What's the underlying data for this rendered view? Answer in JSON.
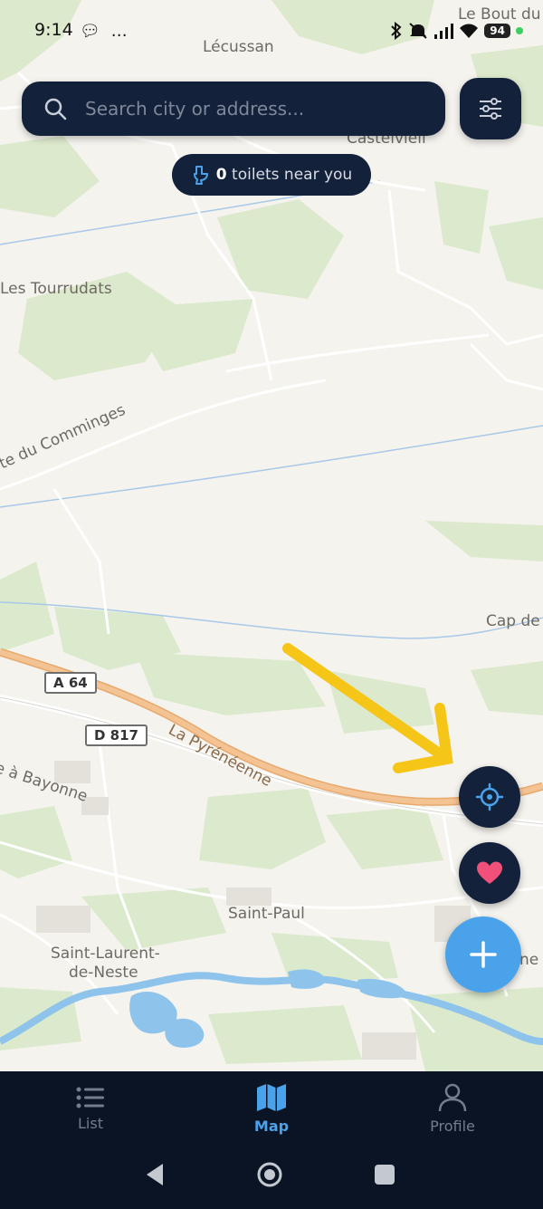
{
  "status_bar": {
    "time": "9:14",
    "battery": "94"
  },
  "search": {
    "placeholder": "Search city or address..."
  },
  "near_you": {
    "count": "0",
    "label": "toilets near you"
  },
  "map_labels": {
    "top_right_place": "Le Bout du",
    "lecussan": "Lécussan",
    "castelvieil": "Castelvieil",
    "tourrudats": "Les Tourrudats",
    "comminges_road": "te du Comminges",
    "cap_de": "Cap de",
    "a64": "A 64",
    "d817": "D 817",
    "pyreneenne": "La Pyrénéenne",
    "bayonne": "e à Bayonne",
    "saint_paul": "Saint-Paul",
    "saint_laurent_1": "Saint-Laurent-",
    "saint_laurent_2": "de-Neste",
    "right_edge_ne": "ne"
  },
  "bottom_nav": {
    "list": "List",
    "map": "Map",
    "profile": "Profile"
  },
  "colors": {
    "dark_panel": "#14213a",
    "accent_blue": "#4aa3ea",
    "heart_pink": "#f0507a",
    "arrow_yellow": "#f5c518"
  },
  "icons": {
    "search": "search-icon",
    "filter": "sliders-icon",
    "toilet": "toilet-icon",
    "locate": "crosshair-icon",
    "favorite": "heart-icon",
    "add": "plus-icon",
    "list": "list-icon",
    "map": "map-icon",
    "profile": "person-icon"
  }
}
